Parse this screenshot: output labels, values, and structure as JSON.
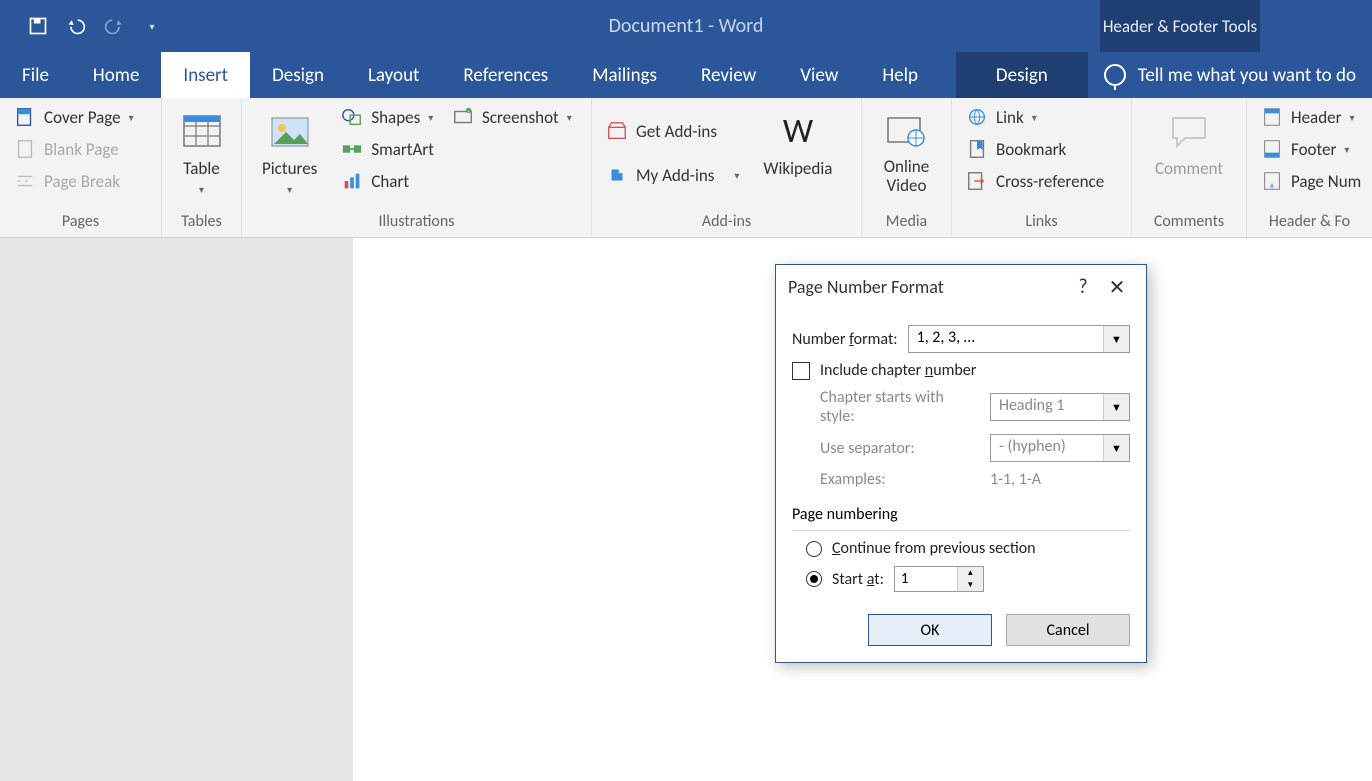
{
  "titlebar": {
    "document": "Document1",
    "separator": "  -  ",
    "app": "Word",
    "contextual": "Header & Footer Tools"
  },
  "tabs": {
    "file": "File",
    "home": "Home",
    "insert": "Insert",
    "design": "Design",
    "layout": "Layout",
    "references": "References",
    "mailings": "Mailings",
    "review": "Review",
    "view": "View",
    "help": "Help",
    "context_design": "Design",
    "tellme": "Tell me what you want to do"
  },
  "ribbon": {
    "pages": {
      "group": "Pages",
      "cover_page": "Cover Page",
      "blank_page": "Blank Page",
      "page_break": "Page Break"
    },
    "tables": {
      "group": "Tables",
      "table": "Table"
    },
    "illustrations": {
      "group": "Illustrations",
      "pictures": "Pictures",
      "shapes": "Shapes",
      "screenshot": "Screenshot",
      "smartart": "SmartArt",
      "chart": "Chart"
    },
    "addins": {
      "group": "Add-ins",
      "get": "Get Add-ins",
      "my": "My Add-ins",
      "wikipedia": "Wikipedia"
    },
    "media": {
      "group": "Media",
      "online_video_l1": "Online",
      "online_video_l2": "Video"
    },
    "links": {
      "group": "Links",
      "link": "Link",
      "bookmark": "Bookmark",
      "crossref": "Cross-reference"
    },
    "comments": {
      "group": "Comments",
      "comment": "Comment"
    },
    "hf": {
      "group": "Header & Fo",
      "header": "Header",
      "footer": "Footer",
      "pagenum": "Page Num"
    }
  },
  "dialog": {
    "title": "Page Number Format",
    "number_format_label": "Number format:",
    "number_format_value": "1, 2, 3, …",
    "include_chapter": "Include chapter number",
    "chapter_starts": "Chapter starts with style:",
    "chapter_starts_value": "Heading 1",
    "use_separator": "Use separator:",
    "use_separator_value": "-   (hyphen)",
    "examples_label": "Examples:",
    "examples_value": "1-1, 1-A",
    "page_numbering": "Page numbering",
    "continue": "Continue from previous section",
    "start_at": "Start at:",
    "start_at_value": "1",
    "ok": "OK",
    "cancel": "Cancel"
  }
}
